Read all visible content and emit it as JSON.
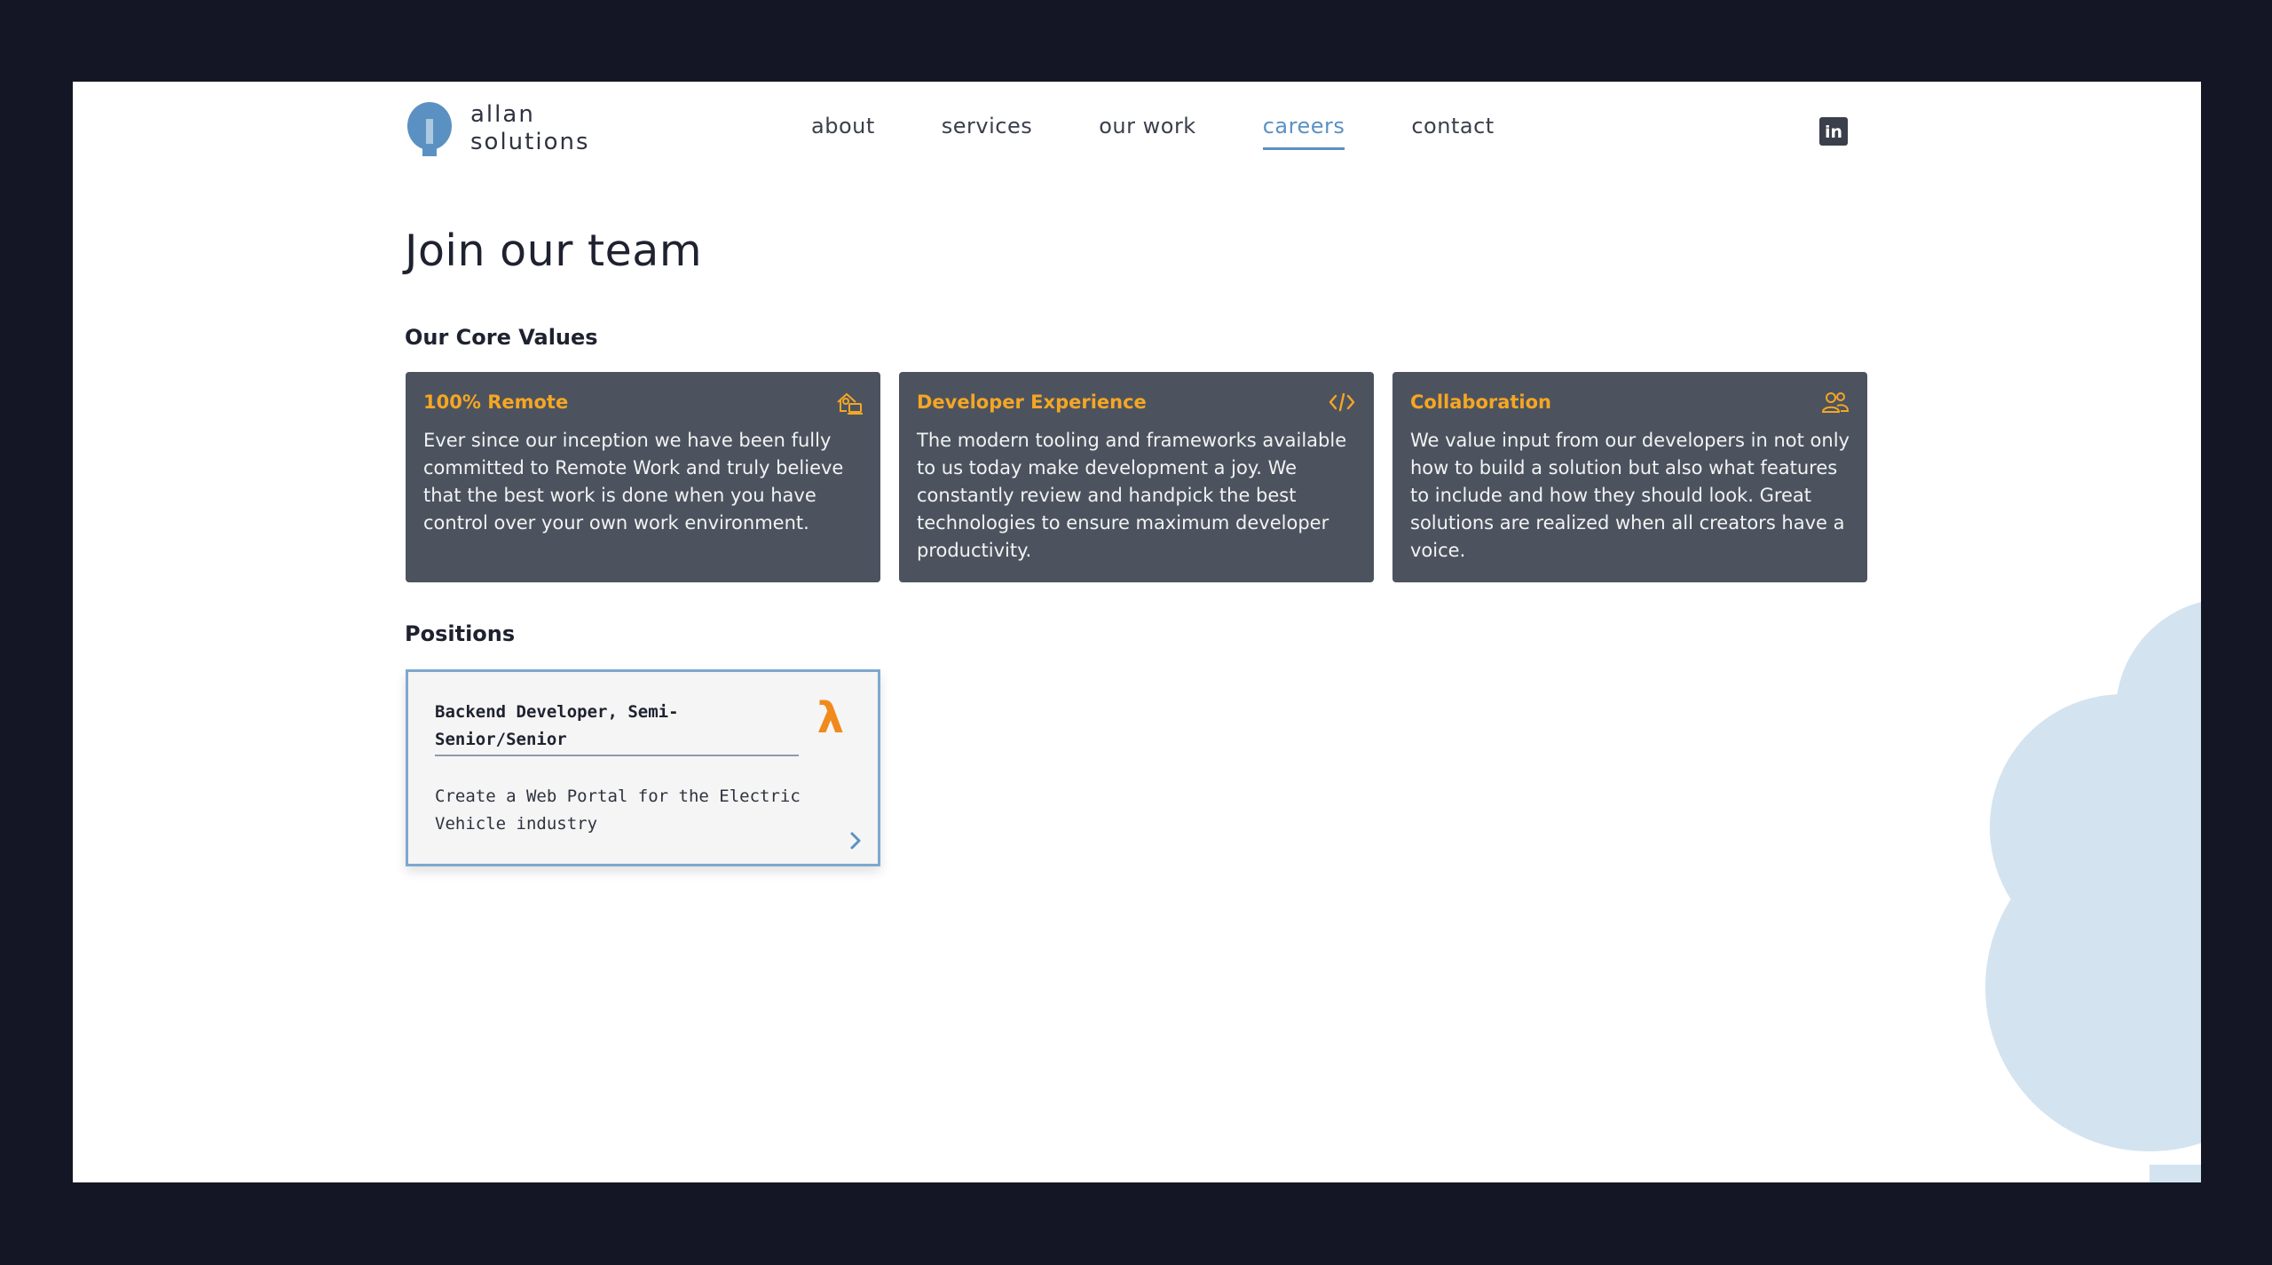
{
  "brand": {
    "line1": "allan",
    "line2": "solutions",
    "accent": "#5b91c2"
  },
  "nav": {
    "items": [
      {
        "label": "about",
        "active": false
      },
      {
        "label": "services",
        "active": false
      },
      {
        "label": "our work",
        "active": false
      },
      {
        "label": "careers",
        "active": true
      },
      {
        "label": "contact",
        "active": false
      }
    ],
    "social_icon": "linkedin-icon",
    "social_text": "in"
  },
  "page": {
    "title": "Join our team",
    "core_values_title": "Our Core Values",
    "positions_title": "Positions"
  },
  "values": [
    {
      "title": "100% Remote",
      "icon": "remote-home-icon",
      "text": "Ever since our inception we have been fully committed to Remote Work and truly believe that the best work is done when you have control over your own work environment."
    },
    {
      "title": "Developer Experience",
      "icon": "code-icon",
      "text": "The modern tooling and frameworks available to us today make development a joy. We constantly review and handpick the best technologies to ensure maximum developer productivity."
    },
    {
      "title": "Collaboration",
      "icon": "users-icon",
      "text": "We value input from our developers in not only how to build a solution but also what features to include and how they should look. Great solutions are realized when all creators have a voice."
    }
  ],
  "positions": [
    {
      "title": "Backend Developer, Semi-Senior/Senior",
      "icon": "lambda-icon",
      "icon_glyph": "λ",
      "description": "Create a Web Portal for the Electric Vehicle industry"
    }
  ],
  "colors": {
    "card_bg": "#4c535f",
    "card_title": "#f5a623",
    "tree": "#d3e3f0",
    "window_bg": "#141626"
  }
}
